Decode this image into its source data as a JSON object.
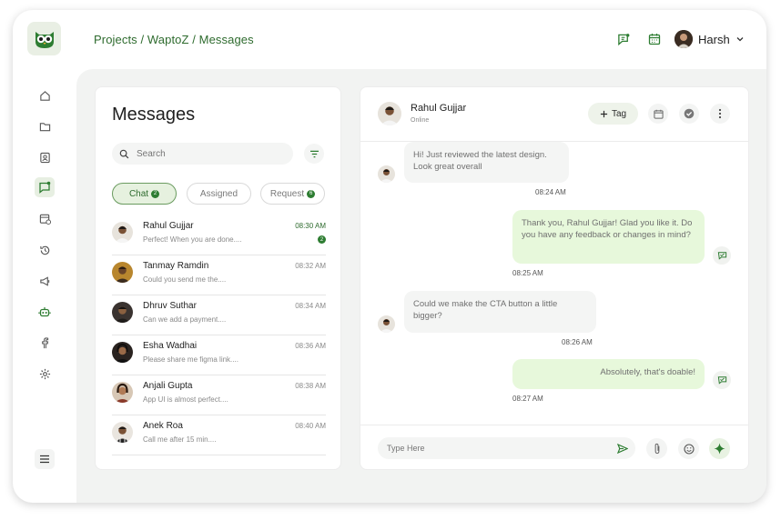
{
  "app": {
    "logo_icon": "owl-logo-icon",
    "brand_color": "#2e7d32",
    "accent_light": "#e7f8db"
  },
  "sidebar": {
    "items": [
      {
        "name": "home",
        "icon": "home-icon",
        "active": false
      },
      {
        "name": "projects",
        "icon": "folder-icon",
        "active": false
      },
      {
        "name": "contacts",
        "icon": "contact-card-icon",
        "active": false
      },
      {
        "name": "messages",
        "icon": "chat-icon",
        "active": true
      },
      {
        "name": "calendar",
        "icon": "calendar-clock-icon",
        "active": false
      },
      {
        "name": "history",
        "icon": "history-icon",
        "active": false
      },
      {
        "name": "campaigns",
        "icon": "megaphone-icon",
        "active": false
      },
      {
        "name": "bot",
        "icon": "robot-icon",
        "active": false
      },
      {
        "name": "facebook",
        "icon": "facebook-icon",
        "active": false
      },
      {
        "name": "settings",
        "icon": "gear-icon",
        "active": false
      }
    ],
    "menu_icon": "hamburger-menu-icon"
  },
  "header": {
    "breadcrumb": "Projects / WaptoZ / Messages",
    "icons": [
      "notes-icon",
      "calendar-icon"
    ],
    "user_name": "Harsh"
  },
  "messages_panel": {
    "title": "Messages",
    "search_placeholder": "Search",
    "tabs": [
      {
        "label": "Chat",
        "count": "2",
        "active": true
      },
      {
        "label": "Assigned",
        "count": "",
        "active": false
      },
      {
        "label": "Request",
        "count": "6",
        "active": false
      }
    ],
    "conversations": [
      {
        "name": "Rahul Gujjar",
        "preview": "Perfect! When you are done....",
        "time": "08:30 AM",
        "unread": "2"
      },
      {
        "name": "Tanmay Ramdin",
        "preview": "Could you send me the....",
        "time": "08:32 AM",
        "unread": ""
      },
      {
        "name": "Dhruv Suthar",
        "preview": "Can we add a payment....",
        "time": "08:34 AM",
        "unread": ""
      },
      {
        "name": "Esha Wadhai",
        "preview": "Please share me figma link....",
        "time": "08:36 AM",
        "unread": ""
      },
      {
        "name": "Anjali Gupta",
        "preview": "App UI is almost perfect....",
        "time": "08:38 AM",
        "unread": ""
      },
      {
        "name": "Anek Roa",
        "preview": "Call me after 15 min....",
        "time": "08:40 AM",
        "unread": ""
      }
    ]
  },
  "chat": {
    "contact_name": "Rahul Gujjar",
    "status": "Online",
    "tag_label": "Tag",
    "header_icons": [
      "calendar-icon",
      "check-circle-icon",
      "more-vertical-icon"
    ],
    "messages": [
      {
        "direction": "in",
        "text": "Hi! Just reviewed the latest design. Look great overall",
        "time": "08:24 AM"
      },
      {
        "direction": "out",
        "text": "Thank you, Rahul Gujjar! Glad you like it. Do you have any feedback or changes in mind?",
        "time": "08:25 AM"
      },
      {
        "direction": "in",
        "text": "Could we make the CTA button a little bigger?",
        "time": "08:26 AM"
      },
      {
        "direction": "out",
        "text": "Absolutely, that's doable!",
        "time": "08:27 AM"
      }
    ],
    "composer_placeholder": "Type Here",
    "composer_icons": [
      "send-icon",
      "paperclip-icon",
      "smiley-icon",
      "sparkle-icon"
    ]
  }
}
